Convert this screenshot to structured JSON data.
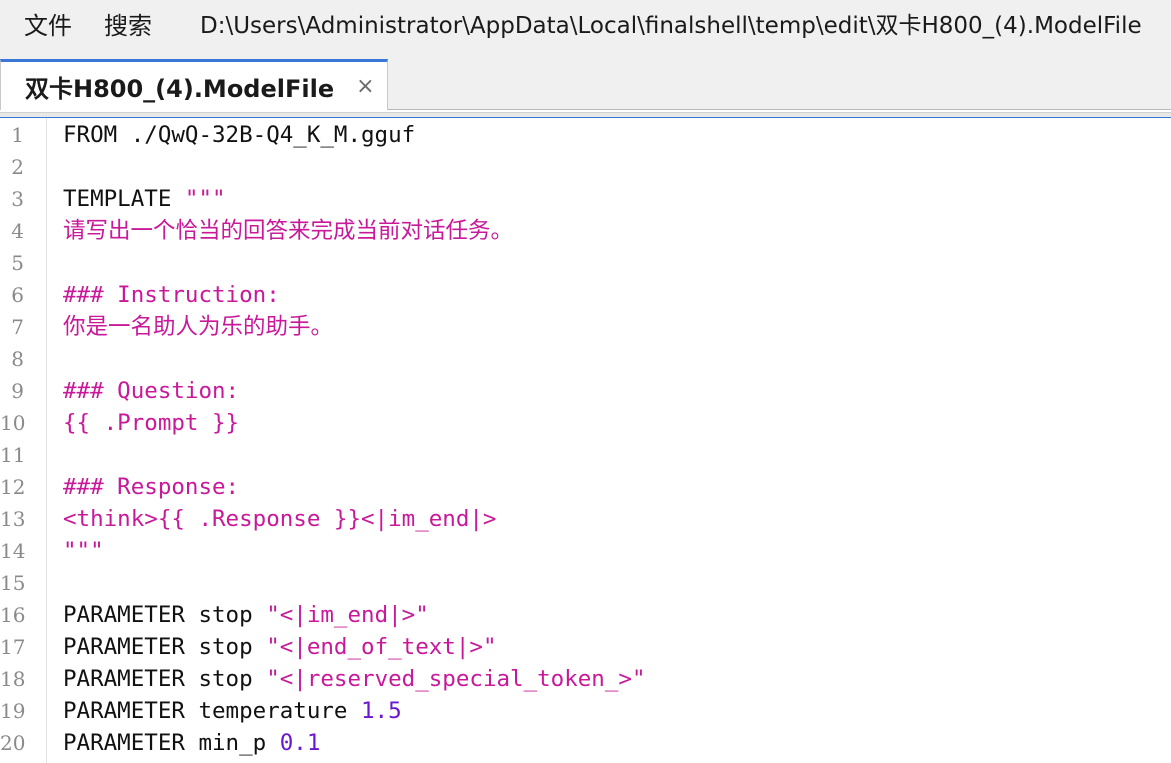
{
  "menubar": {
    "file_label": "文件",
    "search_label": "搜索",
    "filepath": "D:\\Users\\Administrator\\AppData\\Local\\finalshell\\temp\\edit\\双卡H800_(4).ModelFile"
  },
  "tab": {
    "title": "双卡H800_(4).ModelFile",
    "close_glyph": "×"
  },
  "colors": {
    "string": "#c8199a",
    "number": "#6a17d0",
    "default": "#111111",
    "line_number": "#8a8a8a"
  },
  "lines": [
    {
      "n": "1",
      "segs": [
        {
          "t": "FROM ./QwQ-32B-Q4_K_M.gguf",
          "k": "plain"
        }
      ]
    },
    {
      "n": "2",
      "segs": []
    },
    {
      "n": "3",
      "segs": [
        {
          "t": "TEMPLATE ",
          "k": "plain"
        },
        {
          "t": "\"\"\"",
          "k": "str"
        }
      ]
    },
    {
      "n": "4",
      "segs": [
        {
          "t": "请写出一个恰当的回答来完成当前对话任务。",
          "k": "strcjk"
        }
      ]
    },
    {
      "n": "5",
      "segs": []
    },
    {
      "n": "6",
      "segs": [
        {
          "t": "### Instruction:",
          "k": "str"
        }
      ]
    },
    {
      "n": "7",
      "segs": [
        {
          "t": "你是一名助人为乐的助手。",
          "k": "strcjk"
        }
      ]
    },
    {
      "n": "8",
      "segs": []
    },
    {
      "n": "9",
      "segs": [
        {
          "t": "### Question:",
          "k": "str"
        }
      ]
    },
    {
      "n": "10",
      "segs": [
        {
          "t": "{{ .Prompt }}",
          "k": "str"
        }
      ]
    },
    {
      "n": "11",
      "segs": []
    },
    {
      "n": "12",
      "segs": [
        {
          "t": "### Response:",
          "k": "str"
        }
      ]
    },
    {
      "n": "13",
      "segs": [
        {
          "t": "<think>{{ .Response }}<|im_end|>",
          "k": "str"
        }
      ]
    },
    {
      "n": "14",
      "segs": [
        {
          "t": "\"\"\"",
          "k": "str"
        }
      ]
    },
    {
      "n": "15",
      "segs": []
    },
    {
      "n": "16",
      "segs": [
        {
          "t": "PARAMETER stop ",
          "k": "plain"
        },
        {
          "t": "\"<|im_end|>\"",
          "k": "str"
        }
      ]
    },
    {
      "n": "17",
      "segs": [
        {
          "t": "PARAMETER stop ",
          "k": "plain"
        },
        {
          "t": "\"<|end_of_text|>\"",
          "k": "str"
        }
      ]
    },
    {
      "n": "18",
      "segs": [
        {
          "t": "PARAMETER stop ",
          "k": "plain"
        },
        {
          "t": "\"<|reserved_special_token_>\"",
          "k": "str"
        }
      ]
    },
    {
      "n": "19",
      "segs": [
        {
          "t": "PARAMETER temperature ",
          "k": "plain"
        },
        {
          "t": "1.5",
          "k": "num"
        }
      ]
    },
    {
      "n": "20",
      "segs": [
        {
          "t": "PARAMETER min_p ",
          "k": "plain"
        },
        {
          "t": "0.1",
          "k": "num"
        }
      ]
    }
  ]
}
